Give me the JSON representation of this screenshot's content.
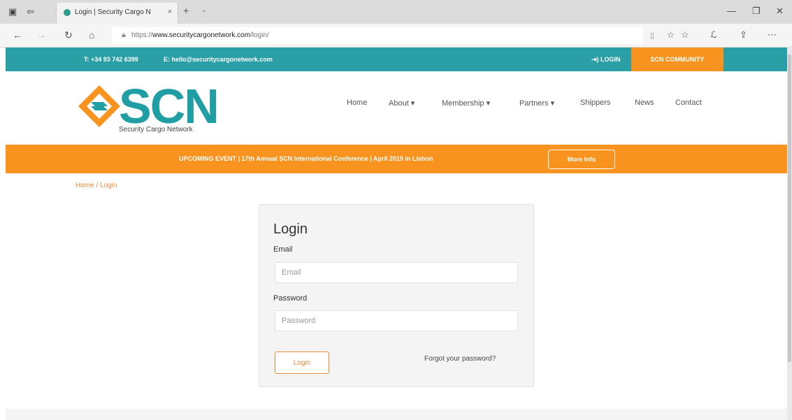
{
  "browser": {
    "tab_title": "Login | Security Cargo N",
    "tab_close": "×",
    "new_tab": "+",
    "tab_dropdown": "⌄",
    "url_prefix": "https://",
    "url_domain": "www.securitycargonetwork.com",
    "url_path": "/login/",
    "controls": {
      "minimize": "—",
      "maximize": "❐",
      "close": "✕"
    },
    "nav": {
      "back": "←",
      "forward": "→",
      "refresh": "↻",
      "home": "⌂"
    }
  },
  "topbar": {
    "phone": "T: +34 93 742 6399",
    "email": "E: hello@securitycargonetwork.com",
    "login": "⇥) LOGIN",
    "community": "SCN COMMUNITY"
  },
  "logo": {
    "word": "SCN",
    "tagline": "Security Cargo Network"
  },
  "menu": {
    "home": "Home",
    "about": "About ▾",
    "membership": "Membership ▾",
    "partners": "Partners ▾",
    "shippers": "Shippers",
    "news": "News",
    "contact": "Contact"
  },
  "event": {
    "message": "UPCOMING EVENT | 17th Annual SCN International Conference | April 2019 in Lisbon",
    "button": "More Info"
  },
  "breadcrumb": "Home / Login",
  "login": {
    "title": "Login",
    "email_label": "Email",
    "email_placeholder": "Email",
    "password_label": "Password",
    "password_placeholder": "Password",
    "submit": "Login",
    "forgot": "Forgot your password?"
  },
  "colors": {
    "teal": "#2aa0a6",
    "orange": "#f7931e"
  }
}
